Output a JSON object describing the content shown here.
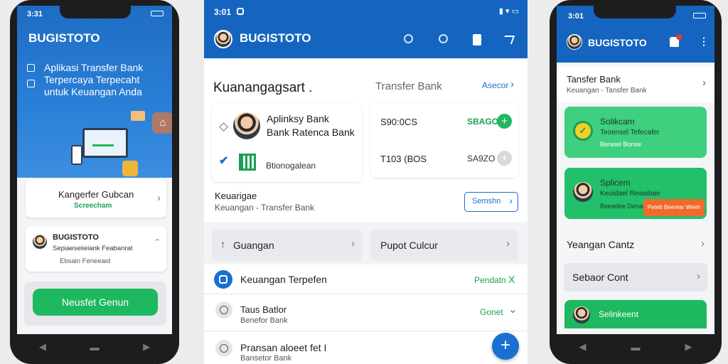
{
  "left": {
    "time": "3:31",
    "title": "BUGISTOTO",
    "intro": [
      "Aplikasi Transfer Bank",
      "Terpercaya Terpecaht",
      "untuk Keuangan Anda"
    ],
    "card1": {
      "title": "Kangerfer Gubcan",
      "sub": "Screecham"
    },
    "card2": {
      "title": "BUGISTOTO",
      "line1": "Sepiaeseiieiank Feabanrat",
      "line2": "Ebsain Feneeaid"
    },
    "button": "Neusfet Genun"
  },
  "middle": {
    "time": "3:01",
    "title": "BUGISTOTO",
    "section_title": "Kuanangagsart .",
    "transfer_label": "Transfer Bank",
    "more_link": "Asecor",
    "profile_card": {
      "line1": "Aplinksy Bank",
      "line2": "Bank Ratenca Bank",
      "option": "Btionogalean"
    },
    "balance1": {
      "value": "S90:0CS",
      "amount": "SBAGO"
    },
    "balance2": {
      "value": "T103 (BOS",
      "amount": "SA9ZO"
    },
    "info": {
      "title": "Keuarigae",
      "sub": "Keuangan - Transfer Bank",
      "button": "Semshn"
    },
    "tabs": [
      "Guangan",
      "Pupot Culcur"
    ],
    "list": [
      {
        "title": "Keuangan  Terpefen",
        "sub": "",
        "status": "Pendatn",
        "action": "X"
      },
      {
        "title": "Taus Batlor",
        "sub": "Benefor Bank",
        "status": "Gonet",
        "action": "⌄"
      },
      {
        "title": "Pransan aloeet fet I",
        "sub": "Bansetor Bank",
        "status": "",
        "action": ""
      }
    ],
    "fab": "+"
  },
  "right": {
    "time": "3:01",
    "title": "BUGISTOTO",
    "item1": {
      "title": "Tansfer Bank",
      "sub": "Keuangan - Tansfer Bank"
    },
    "green1": {
      "title": "Solikcam",
      "line2": "Teoensel Tefecafer",
      "line3": "Beneiel Bonse"
    },
    "green2": {
      "title": "Splicem",
      "line2": "Keoidael Reaaibae",
      "line3": "Beeadee Denaiee",
      "badge": "Peteb Beerear Weeh"
    },
    "row1": "Yeangan Cantz",
    "row2": "Sebaor Cont",
    "green3": "Selinkeent"
  }
}
